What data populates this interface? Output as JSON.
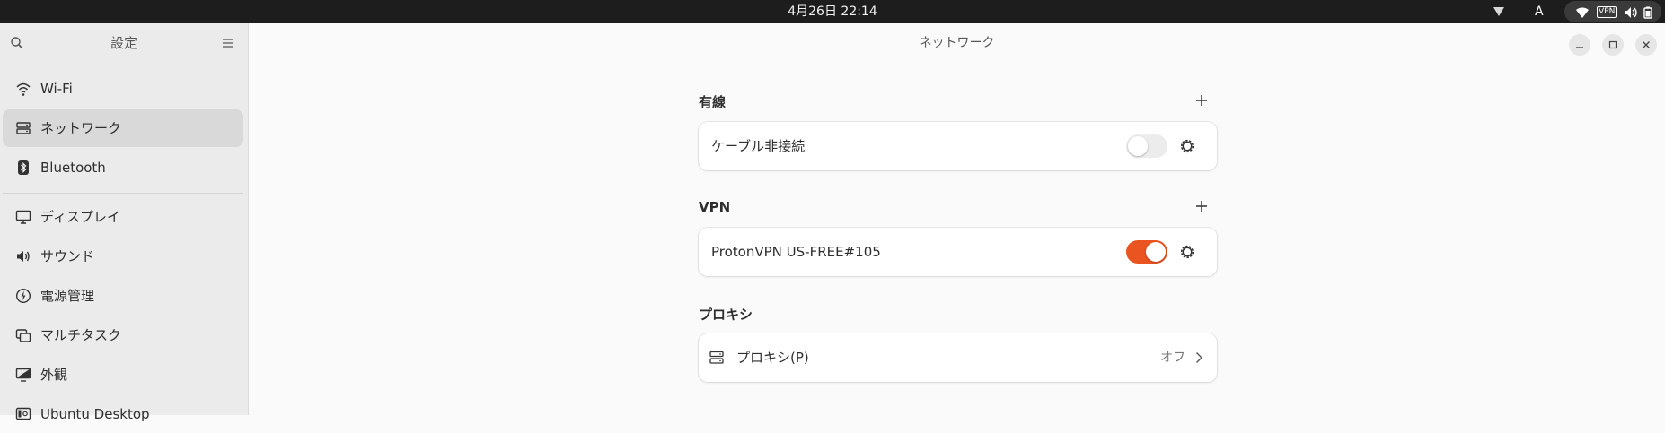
{
  "topbar": {
    "clock": "4月26日  22:14",
    "ime": "A",
    "vpn_badge": "VPN"
  },
  "sidebar": {
    "title": "設定",
    "items": [
      {
        "label": "Wi-Fi",
        "icon": "wifi-icon"
      },
      {
        "label": "ネットワーク",
        "icon": "network-icon",
        "active": true
      },
      {
        "label": "Bluetooth",
        "icon": "bluetooth-icon"
      },
      {
        "label": "ディスプレイ",
        "icon": "display-icon"
      },
      {
        "label": "サウンド",
        "icon": "sound-icon"
      },
      {
        "label": "電源管理",
        "icon": "power-icon"
      },
      {
        "label": "マルチタスク",
        "icon": "multitasking-icon"
      },
      {
        "label": "外観",
        "icon": "appearance-icon"
      },
      {
        "label": "Ubuntu Desktop",
        "icon": "ubuntu-desktop-icon"
      }
    ]
  },
  "main": {
    "title": "ネットワーク",
    "wired": {
      "title": "有線",
      "row_label": "ケーブル非接続",
      "enabled": false
    },
    "vpn": {
      "title": "VPN",
      "row_label": "ProtonVPN US-FREE#105",
      "enabled": true
    },
    "proxy": {
      "title": "プロキシ",
      "row_label": "プロキシ(P)",
      "status": "オフ"
    }
  },
  "colors": {
    "accent": "#e95420",
    "topbar": "#1d1d1d",
    "sidebar": "#ebebeb",
    "background": "#fafafa"
  }
}
